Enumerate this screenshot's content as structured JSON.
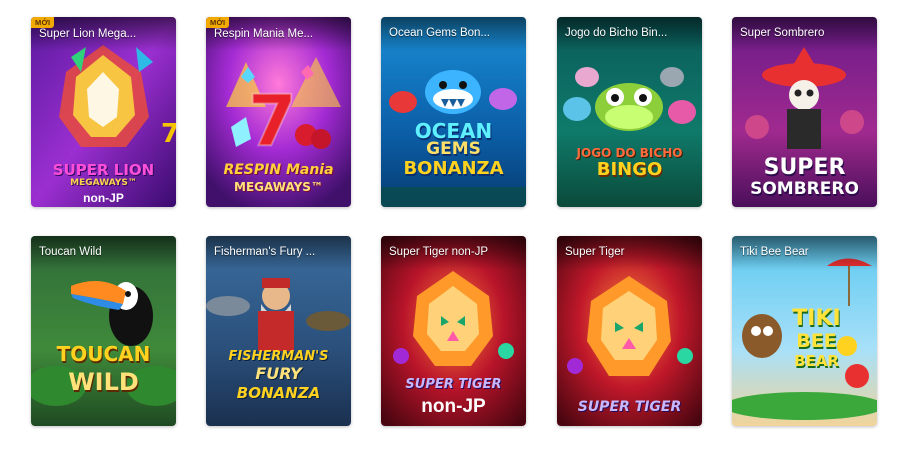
{
  "games": [
    {
      "title": "Super Lion Mega...",
      "badge": "MỚI",
      "logo_1": "SUPER LION",
      "logo_2": "MEGAWAYS™",
      "logo_3": "non-JP"
    },
    {
      "title": "Respin Mania Me...",
      "badge": "MỚI",
      "logo_1": "RESPIN Mania",
      "logo_2": "MEGAWAYS™"
    },
    {
      "title": "Ocean Gems Bon...",
      "logo_1": "OCEAN",
      "logo_2": "GEMS",
      "logo_3": "BONANZA"
    },
    {
      "title": "Jogo do Bicho Bin...",
      "logo_1": "JOGO DO BICHO",
      "logo_2": "BINGO"
    },
    {
      "title": "Super Sombrero",
      "logo_1": "SUPER",
      "logo_2": "SOMBRERO"
    },
    {
      "title": "Toucan Wild",
      "logo_1": "TOUCAN",
      "logo_2": "WILD"
    },
    {
      "title": "Fisherman's Fury ...",
      "logo_1": "FISHERMAN'S",
      "logo_2": "FURY",
      "logo_3": "BONANZA"
    },
    {
      "title": "Super Tiger non-JP",
      "logo_1": "SUPER TIGER",
      "logo_2": "non-JP"
    },
    {
      "title": "Super Tiger",
      "logo_1": "SUPER TIGER"
    },
    {
      "title": "Tiki Bee Bear",
      "logo_1": "TIKI",
      "logo_2": "BEE",
      "logo_3": "BEAR"
    }
  ]
}
